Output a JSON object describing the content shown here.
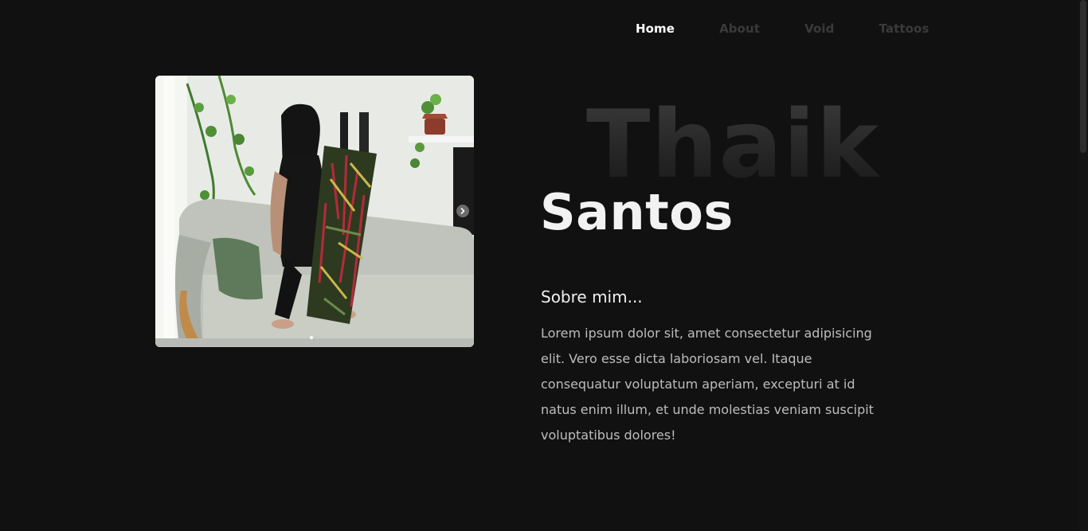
{
  "nav": {
    "items": [
      {
        "label": "Home",
        "active": true
      },
      {
        "label": "About",
        "active": false
      },
      {
        "label": "Void",
        "active": false
      },
      {
        "label": "Tattoos",
        "active": false
      }
    ]
  },
  "hero": {
    "first_name": "Thaik",
    "last_name": "Santos"
  },
  "about": {
    "heading": "Sobre mim...",
    "text": "Lorem ipsum dolor sit, amet consectetur adipisicing elit. Vero esse dicta laboriosam vel. Itaque consequatur voluptatum aperiam, excepturi at id natus enim illum, et unde molestias veniam suscipit voluptatibus dolores!"
  },
  "slider": {
    "slide_count": 2,
    "current_slide": 1,
    "next_icon": "chevron-right-icon"
  },
  "colors": {
    "background": "#111111",
    "nav_active": "#ffffff",
    "nav_inactive": "#3a3a3a",
    "body_text": "#bdbdbd"
  }
}
